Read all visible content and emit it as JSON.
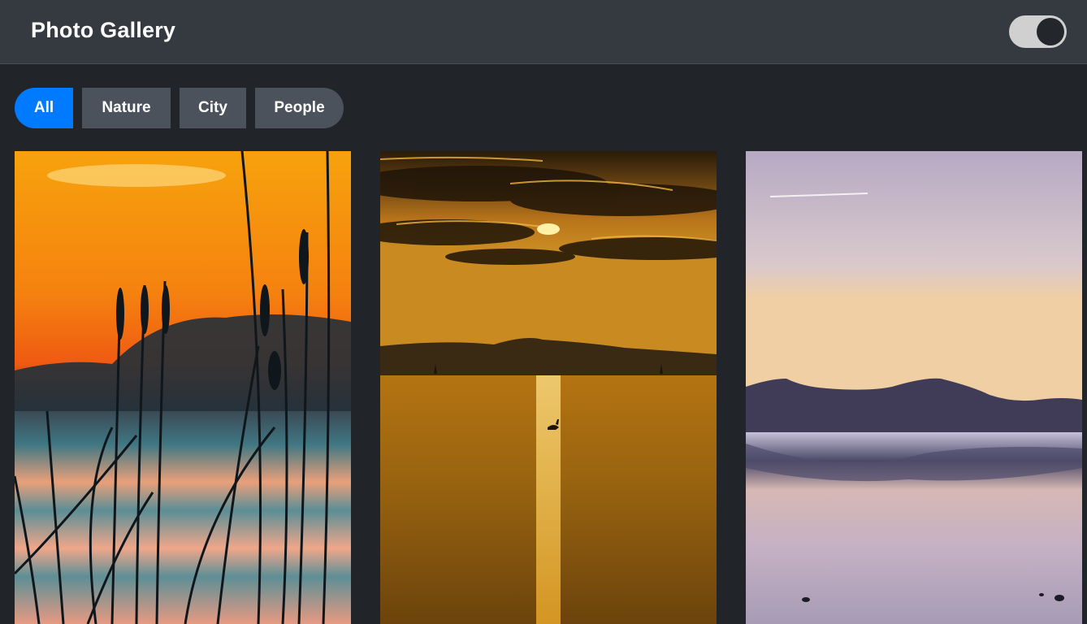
{
  "header": {
    "title": "Photo Gallery",
    "theme_toggle": {
      "state": "on"
    }
  },
  "filters": [
    {
      "label": "All",
      "active": true
    },
    {
      "label": "Nature",
      "active": false
    },
    {
      "label": "City",
      "active": false
    },
    {
      "label": "People",
      "active": false
    }
  ],
  "photos": [
    {
      "subject": "reeds silhouette at sunset over water"
    },
    {
      "subject": "golden sunset over lake with swan"
    },
    {
      "subject": "purple dusk lake with mountain reflection"
    }
  ],
  "colors": {
    "accent": "#007bff",
    "header_bg": "#343a40",
    "page_bg": "#212429",
    "button_bg": "#4b525b"
  }
}
